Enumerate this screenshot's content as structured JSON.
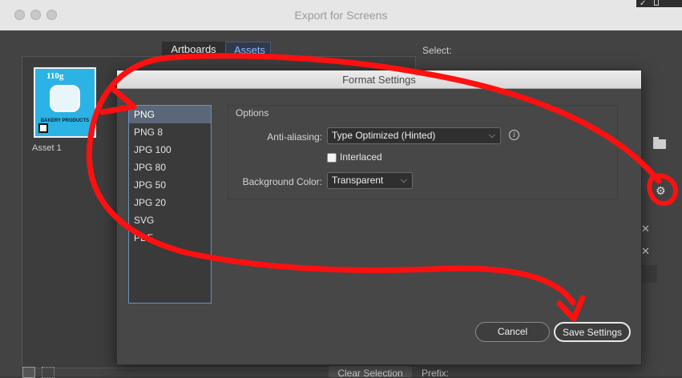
{
  "window": {
    "title": "Export for Screens",
    "tabs": [
      {
        "label": "Artboards",
        "active": false
      },
      {
        "label": "Assets",
        "active": true
      }
    ],
    "select_label": "Select:",
    "asset": {
      "label": "Asset 1",
      "thumb_weight": "110g",
      "thumb_brand": "BAKERY PRODUCTS"
    },
    "clear_selection_label": "Clear Selection",
    "prefix_label": "Prefix:",
    "icons": [
      "folder-icon",
      "gear-icon",
      "close-icon",
      "grid-view-icon",
      "list-view-icon",
      "checkmark-icon"
    ]
  },
  "dialog": {
    "title": "Format Settings",
    "formats": [
      "PNG",
      "PNG 8",
      "JPG 100",
      "JPG 80",
      "JPG 50",
      "JPG 20",
      "SVG",
      "PDF"
    ],
    "selected_format": "PNG",
    "options_legend": "Options",
    "anti_aliasing_label": "Anti-aliasing:",
    "anti_aliasing_value": "Type Optimized (Hinted)",
    "interlaced_label": "Interlaced",
    "interlaced_checked": false,
    "background_label": "Background Color:",
    "background_value": "Transparent",
    "cancel_label": "Cancel",
    "save_label": "Save Settings"
  },
  "colors": {
    "annotation": "#ff1010",
    "selection": "#5b6778",
    "list_border": "#6b8fbf",
    "assets_tab_text": "#8fb4ff"
  }
}
